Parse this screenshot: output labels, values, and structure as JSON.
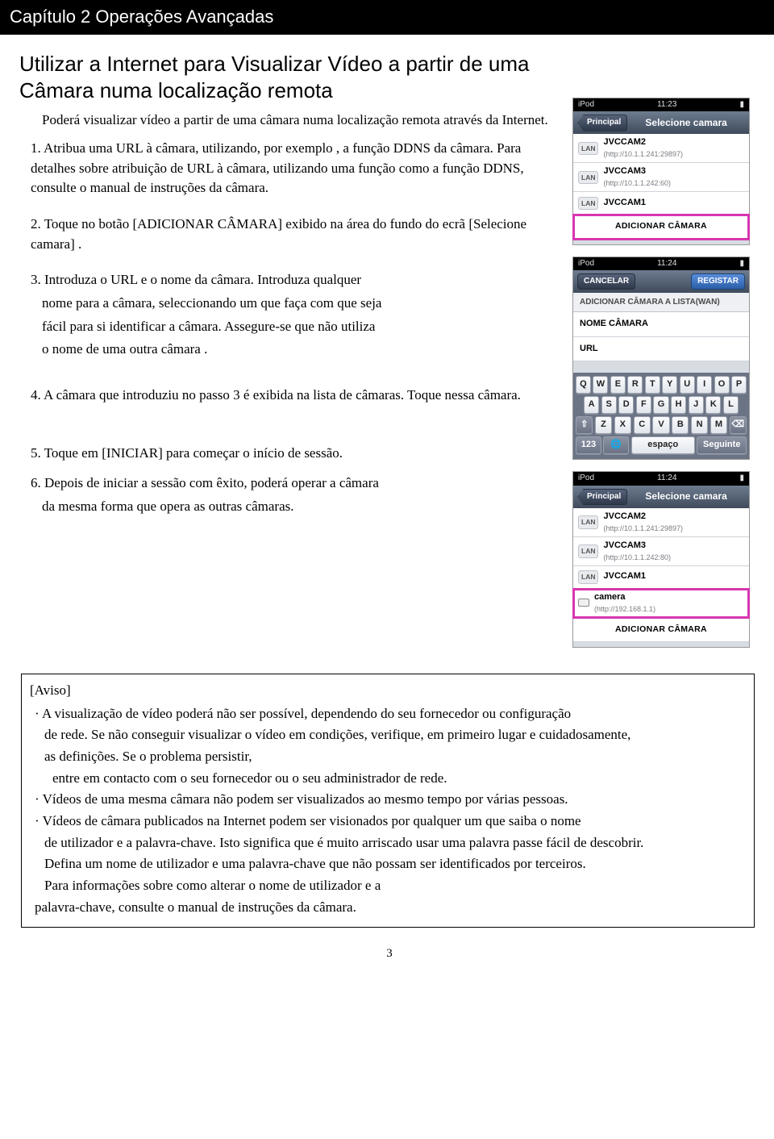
{
  "chapter": {
    "label": "Capítulo 2  Operações Avançadas"
  },
  "title": "Utilizar a Internet para Visualizar Vídeo a partir de uma Câmara numa localização remota",
  "intro": "Poderá visualizar vídeo a partir de uma câmara numa localização remota através da Internet.",
  "steps": {
    "s1": "1. Atribua uma URL à  câmara, utilizando, por exemplo , a função DDNS da câmara. Para detalhes sobre atribuição de URL à câmara, utilizando uma função como a função DDNS, consulte o manual de instruções da câmara.",
    "s2": "2. Toque no botão [ADICIONAR CÂMARA] exibido na área do fundo do ecrã [Selecione camara] .",
    "s3a": "3. Introduza o  URL e o nome da câmara. Introduza qualquer",
    "s3b": "nome para a câmara, seleccionando um que faça com que seja",
    "s3c": "fácil para si identificar a câmara. Assegure-se que não utiliza",
    "s3d": "o nome de uma outra câmara .",
    "s4": "4. A câmara que introduziu no passo 3 é exibida na lista de câmaras. Toque nessa câmara.",
    "s5": "5. Toque em [INICIAR] para começar o início de sessão.",
    "s6a": "6. Depois de iniciar a sessão com êxito, poderá operar a câmara",
    "s6b": "da mesma forma que opera as outras câmaras."
  },
  "aviso": {
    "title": "[Aviso]",
    "l1": "· A visualização de vídeo poderá não ser possível, dependendo do seu fornecedor ou configuração",
    "l1b": "de rede. Se não conseguir visualizar o vídeo em condições, verifique, em primeiro lugar e cuidadosamente,",
    "l1c": "as definições. Se o problema persistir,",
    "l1d": "entre em contacto com o seu fornecedor ou o seu administrador de rede.",
    "l2": "· Vídeos de uma mesma câmara não podem ser visualizados ao mesmo tempo por várias pessoas.",
    "l3": "· Vídeos de câmara publicados na  Internet podem ser visionados por qualquer um que saiba o nome",
    "l3b": "de utilizador e a palavra-chave. Isto significa que é muito arriscado usar uma palavra passe fácil de descobrir.",
    "l3c": "Defina um nome de utilizador e uma palavra-chave que não possam ser identificados por terceiros.",
    "l3d": "Para informações sobre como alterar o nome de utilizador e a",
    "l3e": "palavra-chave, consulte o manual de instruções da câmara."
  },
  "pageNumber": "3",
  "screens": {
    "s1": {
      "device": "iPod",
      "time": "11:23",
      "backLabel": "Principal",
      "title": "Selecione camara",
      "items": [
        {
          "badge": "LAN",
          "name": "JVCCAM2",
          "sub": "(http://10.1.1.241:29897)"
        },
        {
          "badge": "LAN",
          "name": "JVCCAM3",
          "sub": "(http://10.1.1.242:60)"
        },
        {
          "badge": "LAN",
          "name": "JVCCAM1",
          "sub": ""
        }
      ],
      "addLabel": "ADICIONAR CÂMARA"
    },
    "s2": {
      "device": "iPod",
      "time": "11:24",
      "cancelLabel": "CANCELAR",
      "registerLabel": "REGISTAR",
      "header": "ADICIONAR CÂMARA A LISTA(WAN)",
      "field1": "NOME CÂMARA",
      "field2": "URL",
      "kb": {
        "r1": [
          "Q",
          "W",
          "E",
          "R",
          "T",
          "Y",
          "U",
          "I",
          "O",
          "P"
        ],
        "r2": [
          "A",
          "S",
          "D",
          "F",
          "G",
          "H",
          "J",
          "K",
          "L"
        ],
        "r3": [
          "⇧",
          "Z",
          "X",
          "C",
          "V",
          "B",
          "N",
          "M",
          "⌫"
        ],
        "mode": "123",
        "globe": "🌐",
        "space": "espaço",
        "next": "Seguinte"
      }
    },
    "s3": {
      "device": "iPod",
      "time": "11:24",
      "backLabel": "Principal",
      "title": "Selecione camara",
      "items": [
        {
          "badge": "LAN",
          "name": "JVCCAM2",
          "sub": "(http://10.1.1.241:29897)"
        },
        {
          "badge": "LAN",
          "name": "JVCCAM3",
          "sub": "(http://10.1.1.242:80)"
        },
        {
          "badge": "LAN",
          "name": "JVCCAM1",
          "sub": ""
        },
        {
          "badge": "",
          "name": "camera",
          "sub": "(http://192.168.1.1)"
        }
      ],
      "addLabel": "ADICIONAR CÂMARA"
    }
  }
}
